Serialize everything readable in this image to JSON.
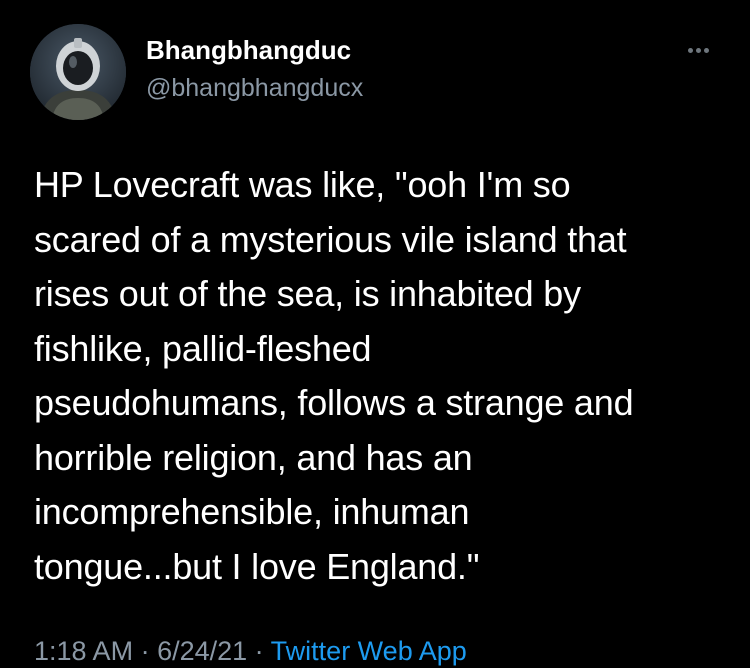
{
  "author": {
    "display_name": "Bhangbhangduc",
    "handle": "@bhangbhangducx",
    "avatar_icon": "astronaut-helmet-avatar"
  },
  "menu": {
    "icon": "more-options-icon"
  },
  "tweet": {
    "text": "HP Lovecraft was like, \"ooh I'm so\nscared of a mysterious vile island that\nrises out of the sea, is inhabited by\nfishlike, pallid-fleshed\npseudohumans, follows a strange and\nhorrible religion, and has an\nincomprehensible, inhuman\ntongue...but I love England.\""
  },
  "meta": {
    "time": "1:18 AM",
    "separator": " · ",
    "date": "6/24/21",
    "source": "Twitter Web App"
  },
  "colors": {
    "background": "#000000",
    "text": "#ffffff",
    "secondary": "#8b98a5",
    "link": "#1d9bf0"
  }
}
